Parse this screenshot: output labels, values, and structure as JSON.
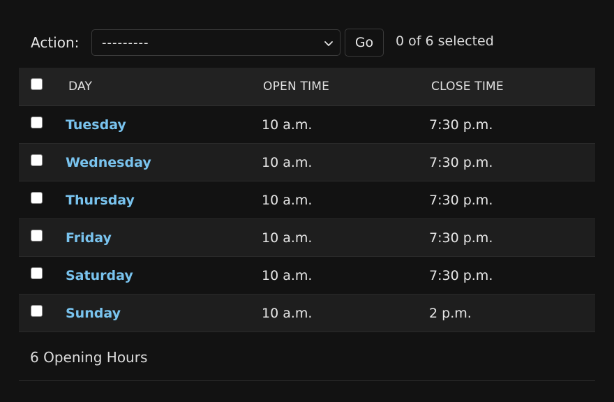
{
  "actions": {
    "label": "Action:",
    "selected_value": "---------",
    "go_label": "Go",
    "selection_status": "0 of 6 selected"
  },
  "table": {
    "headers": {
      "day": "DAY",
      "open_time": "OPEN TIME",
      "close_time": "CLOSE TIME"
    },
    "rows": [
      {
        "day": "Tuesday",
        "open_time": "10 a.m.",
        "close_time": "7:30 p.m."
      },
      {
        "day": "Wednesday",
        "open_time": "10 a.m.",
        "close_time": "7:30 p.m."
      },
      {
        "day": "Thursday",
        "open_time": "10 a.m.",
        "close_time": "7:30 p.m."
      },
      {
        "day": "Friday",
        "open_time": "10 a.m.",
        "close_time": "7:30 p.m."
      },
      {
        "day": "Saturday",
        "open_time": "10 a.m.",
        "close_time": "7:30 p.m."
      },
      {
        "day": "Sunday",
        "open_time": "10 a.m.",
        "close_time": "2 p.m."
      }
    ]
  },
  "footer": {
    "count_text": "6 Opening Hours"
  },
  "colors": {
    "background": "#121212",
    "link": "#79c3ee",
    "header_bg": "#222222",
    "alt_row_bg": "#1e1e1e"
  },
  "icons": {
    "select_arrow": "chevron-down-icon"
  }
}
